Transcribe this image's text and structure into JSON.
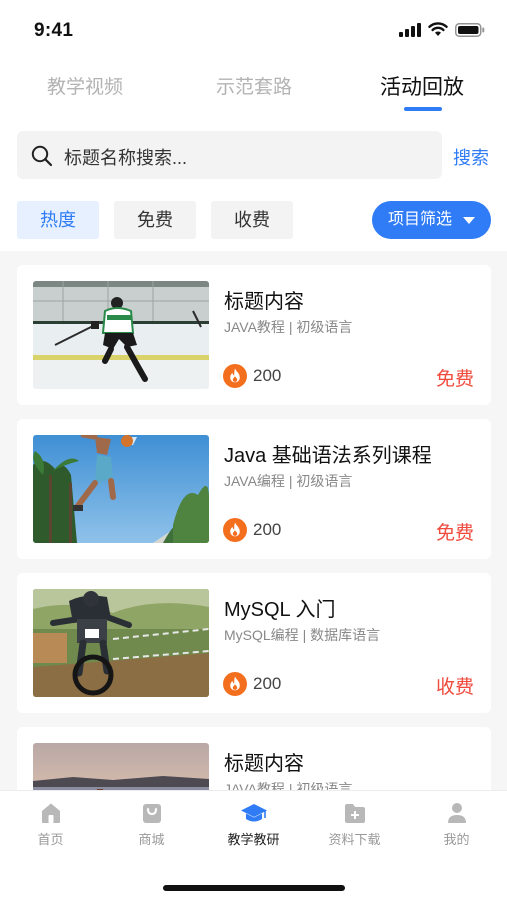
{
  "status": {
    "time": "9:41"
  },
  "tabs": [
    {
      "label": "教学视频"
    },
    {
      "label": "示范套路"
    },
    {
      "label": "活动回放"
    }
  ],
  "search": {
    "placeholder": "标题名称搜索...",
    "button": "搜索"
  },
  "chips": [
    {
      "label": "热度"
    },
    {
      "label": "免费"
    },
    {
      "label": "收费"
    }
  ],
  "filter": {
    "label": "项目筛选"
  },
  "cards": [
    {
      "title": "标题内容",
      "subtitle": "JAVA教程 | 初级语言",
      "count": "200",
      "price": "免费",
      "thumb": "ice-hockey-photo"
    },
    {
      "title": "Java 基础语法系列课程",
      "subtitle": "JAVA编程 | 初级语言",
      "count": "200",
      "price": "免费",
      "thumb": "basketball-dunk-photo"
    },
    {
      "title": "MySQL 入门",
      "subtitle": "MySQL编程 | 数据库语言",
      "count": "200",
      "price": "收费",
      "thumb": "mountain-bike-photo"
    },
    {
      "title": "标题内容",
      "subtitle": "JAVA教程 | 初级语言",
      "count": "",
      "price": "",
      "thumb": "sunset-lake-photo"
    }
  ],
  "nav": [
    {
      "label": "首页",
      "icon": "home-icon"
    },
    {
      "label": "商城",
      "icon": "shop-bag-icon"
    },
    {
      "label": "教学教研",
      "icon": "graduation-cap-icon"
    },
    {
      "label": "资料下载",
      "icon": "folder-plus-icon"
    },
    {
      "label": "我的",
      "icon": "user-icon"
    }
  ],
  "colors": {
    "accent": "#2f7cf6",
    "price": "#f04a3c",
    "fire": "#f36f1e"
  }
}
